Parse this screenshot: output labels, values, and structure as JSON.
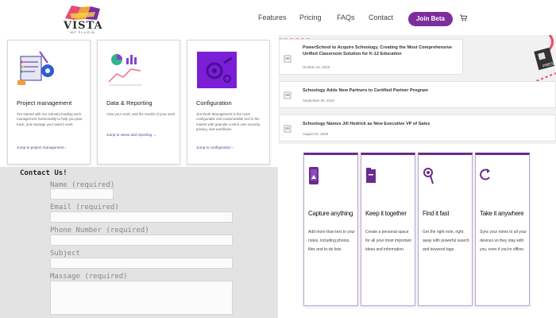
{
  "brand": {
    "logo_name": "VISTA",
    "logo_sub": "WP PLUGIN",
    "accent": "#7b2f9c"
  },
  "nav": {
    "features": "Features",
    "pricing": "Pricing",
    "faqs": "FAQs",
    "contact": "Contact",
    "cta": "Join Beta",
    "cart_icon": "cart-icon"
  },
  "feature_cards": [
    {
      "title": "Project management",
      "desc": "Get started with our industry-leading work management functionality to help you plan, track, and manage your team's work.",
      "link": "Jump to project management ›",
      "icon": "project-illustration"
    },
    {
      "title": "Data & Reporting",
      "desc": "View your work, and the results of your work",
      "link": "Jump to views and reporting →",
      "icon": "chart-illustration"
    },
    {
      "title": "Configuration",
      "desc": "Jira Work Management is the most configurable and customizable tool in the market with granular control over security, privacy, and workflows.",
      "link": "Jump to configuration ›",
      "icon": "gears-illustration"
    }
  ],
  "contact_form": {
    "title": "Contact Us!",
    "name_label": "Name (required)",
    "email_label": "Email (required)",
    "phone_label": "Phone Number (required)",
    "subject_label": "Subject",
    "message_label": "Massage (required)"
  },
  "news": [
    {
      "title": "PowerSchool to Acquire Schoology, Creating the Most Comprehensive Unified Classroom Solution for K-12 Education",
      "date": "October 24, 2019"
    },
    {
      "title": "Schoology Adds New Partners to Certified Partner Program",
      "date": "September 05, 2019"
    },
    {
      "title": "Schoology Names Jill Hedrick as New Executive VP of Sales",
      "date": "August 22, 2019"
    }
  ],
  "news_photo_text": "PRESS",
  "app_cards": [
    {
      "title": "Capture anything",
      "desc": "Add more than text to your notes, including photos, files and to-do lists.",
      "icon": "phone-note-icon"
    },
    {
      "title": "Keep it together",
      "desc": "Create a personal space for all your most important ideas and information.",
      "icon": "folder-icon"
    },
    {
      "title": "Find it fast",
      "desc": "Get the right note, right away with powerful search and keyword tags.",
      "icon": "search-icon"
    },
    {
      "title": "Take it anywhere",
      "desc": "Sync your notes to all your devices so they stay with you, even if you're offline.",
      "icon": "sync-icon"
    }
  ]
}
